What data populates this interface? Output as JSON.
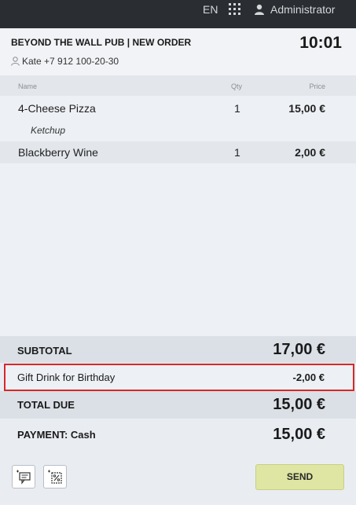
{
  "topbar": {
    "language": "EN",
    "user_name": "Administrator"
  },
  "header": {
    "venue": "BEYOND THE WALL PUB",
    "separator": "|",
    "order_type": "NEW ORDER",
    "time": "10:01",
    "customer": "Kate +7 912 100-20-30"
  },
  "columns": {
    "name": "Name",
    "qty": "Qty",
    "price": "Price"
  },
  "items": [
    {
      "name": "4-Cheese Pizza",
      "qty": "1",
      "price": "15,00 €",
      "modifier": "Ketchup"
    },
    {
      "name": "Blackberry Wine",
      "qty": "1",
      "price": "2,00 €"
    }
  ],
  "totals": {
    "subtotal_label": "SUBTOTAL",
    "subtotal_value": "17,00 €",
    "discount_label": "Gift Drink for Birthday",
    "discount_value": "-2,00 €",
    "total_label": "TOTAL DUE",
    "total_value": "15,00 €",
    "payment_label": "PAYMENT: Cash",
    "payment_value": "15,00 €"
  },
  "actions": {
    "send_label": "SEND"
  },
  "colors": {
    "topbar": "#2a2d31",
    "highlight_border": "#d62828",
    "send_button": "#dfe6a3"
  }
}
